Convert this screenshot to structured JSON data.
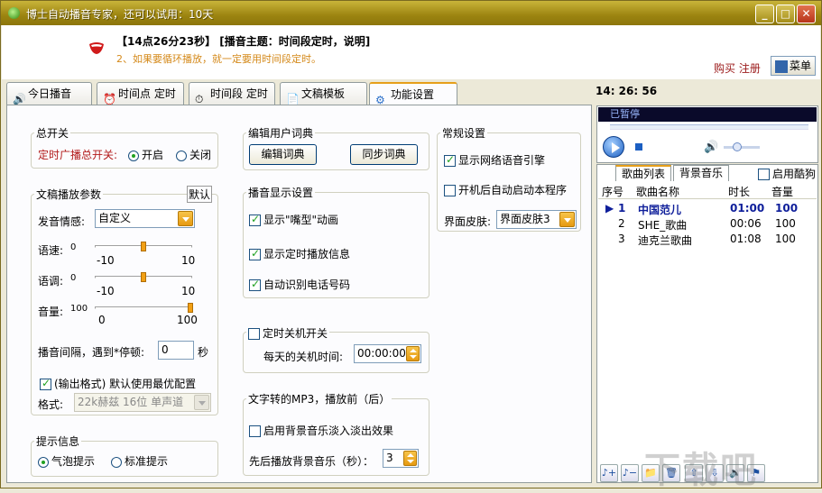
{
  "window": {
    "title": "博士自动播音专家，还可以试用：10天"
  },
  "header": {
    "announce_line1": "【14点26分23秒】 [播音主题：时间段定时，说明]",
    "announce_line2": "2、如果要循环播放，就一定要用时间段定时。",
    "buy_register": "购买 注册",
    "menu_label": "菜单"
  },
  "tabs": [
    "今日播音",
    "时间点 定时",
    "时间段 定时",
    "文稿模板",
    "功能设置"
  ],
  "settings": {
    "master": {
      "title": "总开关",
      "label": "定时广播总开关:",
      "on": "开启",
      "off": "关闭"
    },
    "playback": {
      "title": "文稿播放参数",
      "default_btn": "默认",
      "emotion_label": "发音情感:",
      "emotion_value": "自定义",
      "speed_label": "语速:",
      "speed_value": "0",
      "speed_min": "-10",
      "speed_max": "10",
      "tone_label": "语调:",
      "tone_value": "0",
      "tone_min": "-10",
      "tone_max": "10",
      "volume_label": "音量:",
      "volume_value": "100",
      "volume_min": "0",
      "volume_max": "100",
      "interval_label": "播音间隔，遇到*停顿:",
      "interval_value": "0",
      "interval_unit": "秒",
      "output_chk": "(输出格式) 默认使用最优配置",
      "format_label": "格式:",
      "format_value": "22k赫兹 16位 单声道"
    },
    "hint": {
      "title": "提示信息",
      "bubble": "气泡提示",
      "standard": "标准提示"
    },
    "dict": {
      "title": "编辑用户词典",
      "edit": "编辑词典",
      "sync": "同步词典"
    },
    "display": {
      "title": "播音显示设置",
      "mouth": "显示\"嘴型\"动画",
      "timer_info": "显示定时播放信息",
      "phone": "自动识别电话号码"
    },
    "shutdown": {
      "title": "定时关机开关",
      "label": "每天的关机时间:",
      "time": "00:00:00"
    },
    "mp3": {
      "title": "文字转的MP3，播放前（后）",
      "fade": "启用背景音乐淡入淡出效果",
      "bg_label": "先后播放背景音乐（秒）：",
      "bg_value": "3"
    },
    "general": {
      "title": "常规设置",
      "engine": "显示网络语音引擎",
      "autostart": "开机后自动启动本程序",
      "skin_label": "界面皮肤:",
      "skin_value": "界面皮肤3"
    }
  },
  "clock": "14: 26: 56",
  "player": {
    "status": "已暂停"
  },
  "playlist": {
    "tabs": [
      "歌曲列表",
      "背景音乐"
    ],
    "enable_cool": "启用酷狗",
    "columns": [
      "序号",
      "歌曲名称",
      "时长",
      "音量"
    ],
    "rows": [
      {
        "no": "1",
        "name": "中国范儿",
        "dur": "01:00",
        "vol": "100"
      },
      {
        "no": "2",
        "name": "SHE_歌曲",
        "dur": "00:06",
        "vol": "100"
      },
      {
        "no": "3",
        "name": "迪克兰歌曲",
        "dur": "01:08",
        "vol": "100"
      }
    ]
  },
  "watermark": "下载吧"
}
